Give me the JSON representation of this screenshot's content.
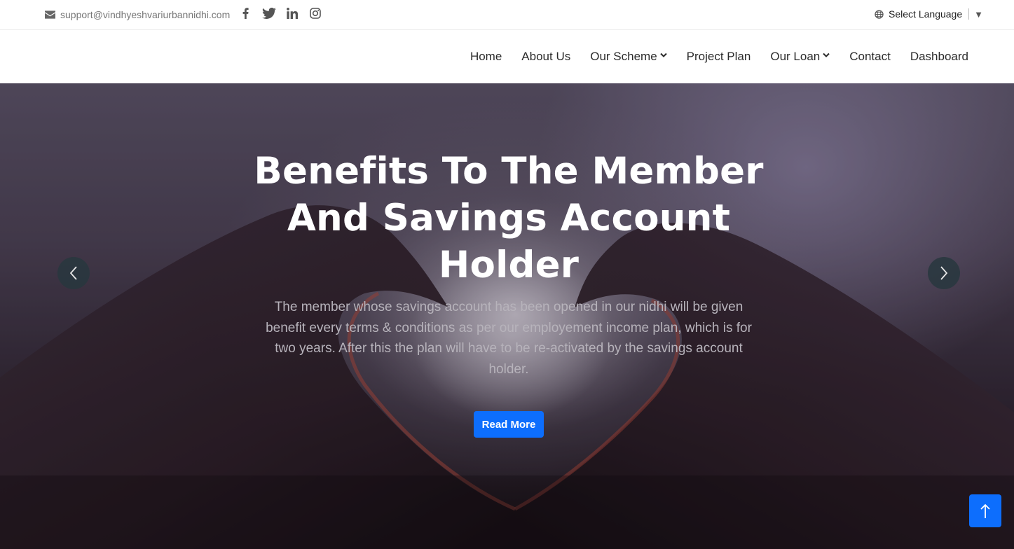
{
  "topbar": {
    "email": "support@vindhyeshvariurbannidhi.com",
    "social_icons": [
      "facebook-icon",
      "twitter-icon",
      "linkedin-icon",
      "instagram-icon"
    ],
    "language_label": "Select Language",
    "language_arrow": "▼"
  },
  "nav": {
    "items": [
      {
        "label": "Home",
        "dropdown": false
      },
      {
        "label": "About Us",
        "dropdown": false
      },
      {
        "label": "Our Scheme",
        "dropdown": true
      },
      {
        "label": "Project Plan",
        "dropdown": false
      },
      {
        "label": "Our Loan",
        "dropdown": true
      },
      {
        "label": "Contact",
        "dropdown": false
      },
      {
        "label": "Dashboard",
        "dropdown": false
      }
    ]
  },
  "hero": {
    "title": "Benefits To The Member And Savings Account Holder",
    "description": "The member whose savings account has been opened in our nidhi will be given benefit every terms & conditions as per our employement income plan, which is for two years. After this the plan will have to be re-activated by the savings account holder.",
    "cta_label": "Read More",
    "prev_icon": "chevron-left-icon",
    "next_icon": "chevron-right-icon"
  },
  "scroll_top": {
    "icon": "arrow-up-icon"
  },
  "colors": {
    "accent": "#0d6efd",
    "arrow_bg": "#28373e",
    "text_dark": "#2b2b2b"
  }
}
